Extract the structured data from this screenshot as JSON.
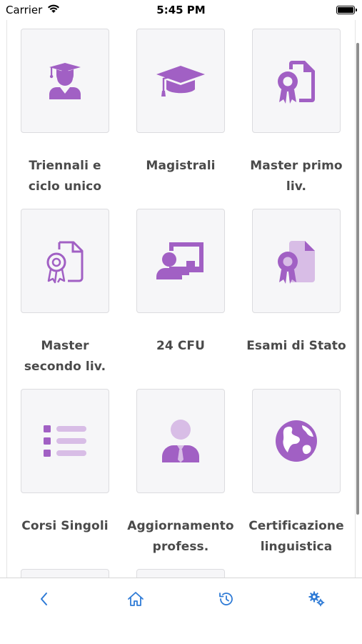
{
  "status_bar": {
    "carrier": "Carrier",
    "time": "5:45 PM",
    "battery_level": 1.0
  },
  "colors": {
    "accent_purple": "#a160c4",
    "accent_light": "#d8bde6",
    "tab_blue": "#2f7bd6",
    "label": "#4a4a4a",
    "tile_bg": "#f6f6f8"
  },
  "tiles": [
    {
      "label": "Triennali e ciclo unico",
      "icon": "graduate-student-icon"
    },
    {
      "label": "Magistrali",
      "icon": "graduation-cap-icon"
    },
    {
      "label": "Master primo liv.",
      "icon": "certificate-document-icon"
    },
    {
      "label": "Master secondo liv.",
      "icon": "certificate-outline-icon"
    },
    {
      "label": "24 CFU",
      "icon": "teacher-board-icon"
    },
    {
      "label": "Esami di Stato",
      "icon": "certificate-award-icon"
    },
    {
      "label": "Corsi Singoli",
      "icon": "list-icon"
    },
    {
      "label": "Aggiornamento profess.",
      "icon": "professional-person-icon"
    },
    {
      "label": "Certificazione linguistica",
      "icon": "globe-icon"
    }
  ],
  "tab_bar": [
    {
      "name": "back",
      "icon": "chevron-left-icon"
    },
    {
      "name": "home",
      "icon": "home-icon"
    },
    {
      "name": "history",
      "icon": "history-icon"
    },
    {
      "name": "settings",
      "icon": "gears-icon"
    }
  ]
}
